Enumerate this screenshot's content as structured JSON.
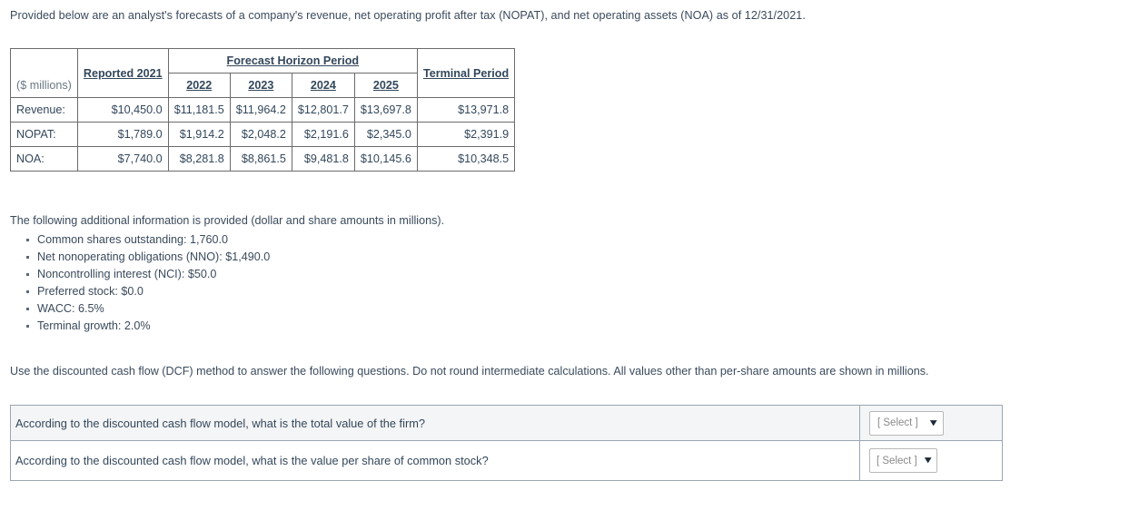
{
  "intro": "Provided below are an analyst's forecasts of a company's revenue, net operating profit after tax (NOPAT), and net operating assets (NOA) as of 12/31/2021.",
  "forecast_table": {
    "group_header": "Forecast Horizon Period",
    "unit_label": "($ millions)",
    "reported_header": "Reported 2021",
    "year_headers": [
      "2022",
      "2023",
      "2024",
      "2025"
    ],
    "terminal_header": "Terminal Period",
    "rows": [
      {
        "label": "Revenue:",
        "reported": "$10,450.0",
        "years": [
          "$11,181.5",
          "$11,964.2",
          "$12,801.7",
          "$13,697.8"
        ],
        "terminal": "$13,971.8"
      },
      {
        "label": "NOPAT:",
        "reported": "$1,789.0",
        "years": [
          "$1,914.2",
          "$2,048.2",
          "$2,191.6",
          "$2,345.0"
        ],
        "terminal": "$2,391.9"
      },
      {
        "label": "NOA:",
        "reported": "$7,740.0",
        "years": [
          "$8,281.8",
          "$8,861.5",
          "$9,481.8",
          "$10,145.6"
        ],
        "terminal": "$10,348.5"
      }
    ]
  },
  "additional_info": {
    "lead": "The following additional information is provided (dollar and share amounts in millions).",
    "items": [
      "Common shares outstanding: 1,760.0",
      "Net nonoperating obligations (NNO): $1,490.0",
      "Noncontrolling interest (NCI): $50.0",
      "Preferred stock: $0.0",
      "WACC: 6.5%",
      "Terminal growth: 2.0%"
    ]
  },
  "usage_note": "Use the discounted cash flow (DCF) method to answer the following questions. Do not round intermediate calculations. All values other than per-share amounts are shown in millions.",
  "questions": [
    {
      "text": "According to the discounted cash flow model, what is the total value of the firm?",
      "select_value": "[ Select ]",
      "chevron": "⌄"
    },
    {
      "text": "According to the discounted cash flow model, what is the value per share of common stock?",
      "select_value": "[ Select ]",
      "chevron": "⌄"
    }
  ],
  "colors": {
    "text": "#33475b",
    "muted": "#6a7884",
    "table_border": "#6b6b6b",
    "question_border": "#9aa6b2",
    "row_highlight": "#f4f5f6"
  }
}
